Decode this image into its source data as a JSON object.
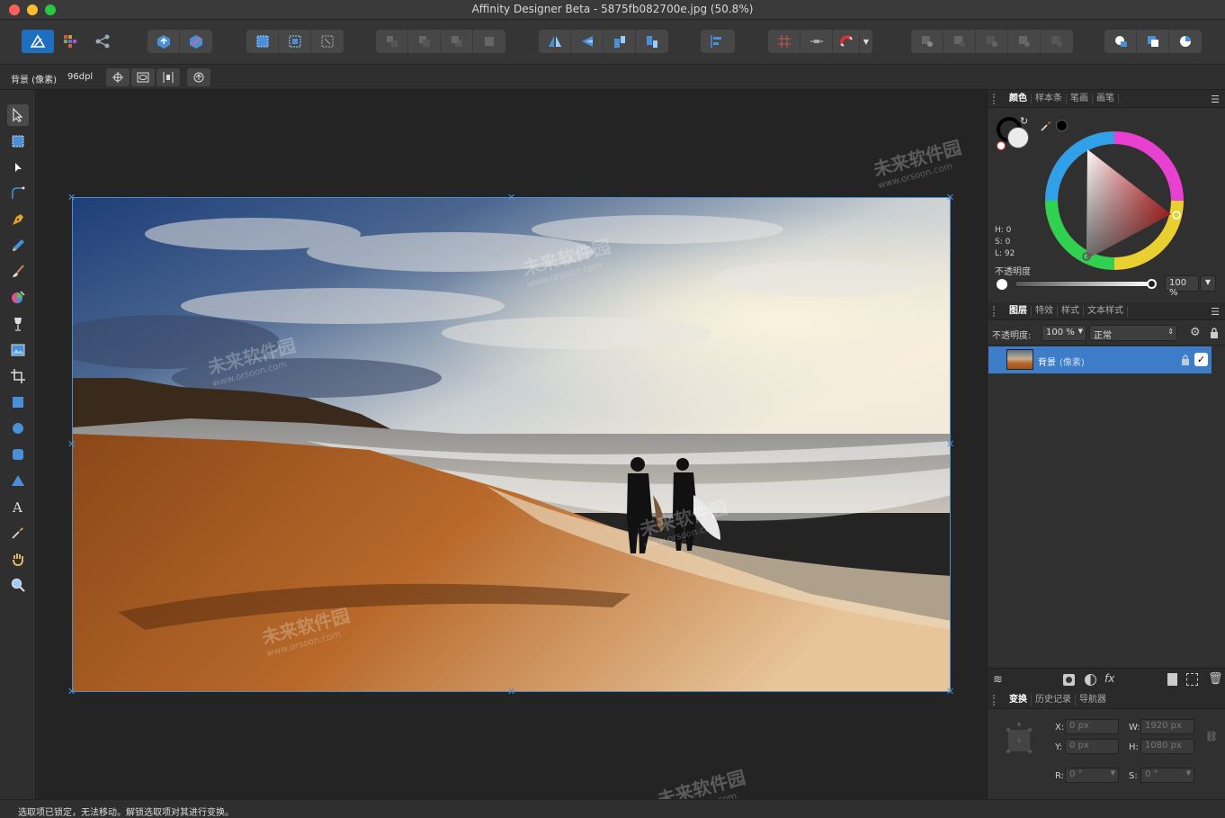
{
  "window": {
    "title": "Affinity Designer Beta - 5875fb082700e.jpg (50.8%)"
  },
  "context_toolbar": {
    "layer_name": "背景 (像素)",
    "dpi": "96dpl"
  },
  "color_panel": {
    "tabs": [
      "颜色",
      "样本条",
      "笔画",
      "画笔"
    ],
    "h": "H: 0",
    "s": "S: 0",
    "l": "L: 92",
    "opacity_label": "不透明度",
    "opacity_value": "100 %",
    "opacity_fraction": 1.0,
    "fill_color": "#ebebeb",
    "stroke_color": "#000000",
    "wheel_hue": "#e82a2a"
  },
  "layers_panel": {
    "tabs": [
      "图层",
      "特效",
      "样式",
      "文本样式"
    ],
    "opacity_label": "不透明度:",
    "opacity_value": "100 %",
    "blend_mode": "正常",
    "layer_name": "背景",
    "layer_type": "(像素)",
    "selected_color": "#3d7cc9"
  },
  "transform_panel": {
    "tabs": [
      "变换",
      "历史记录",
      "导航器"
    ],
    "x_label": "X:",
    "x_value": "0 px",
    "y_label": "Y:",
    "y_value": "0 px",
    "w_label": "W:",
    "w_value": "1920 px",
    "h_label": "H:",
    "h_value": "1080 px",
    "r_label": "R:",
    "r_value": "0 °",
    "s_label": "S:",
    "s_value": "0 °"
  },
  "status": {
    "message": "选取项已锁定，无法移动。解锁选取项对其进行变换。"
  },
  "watermark": {
    "cn": "未来软件园",
    "url": "www.orsoon.com"
  }
}
